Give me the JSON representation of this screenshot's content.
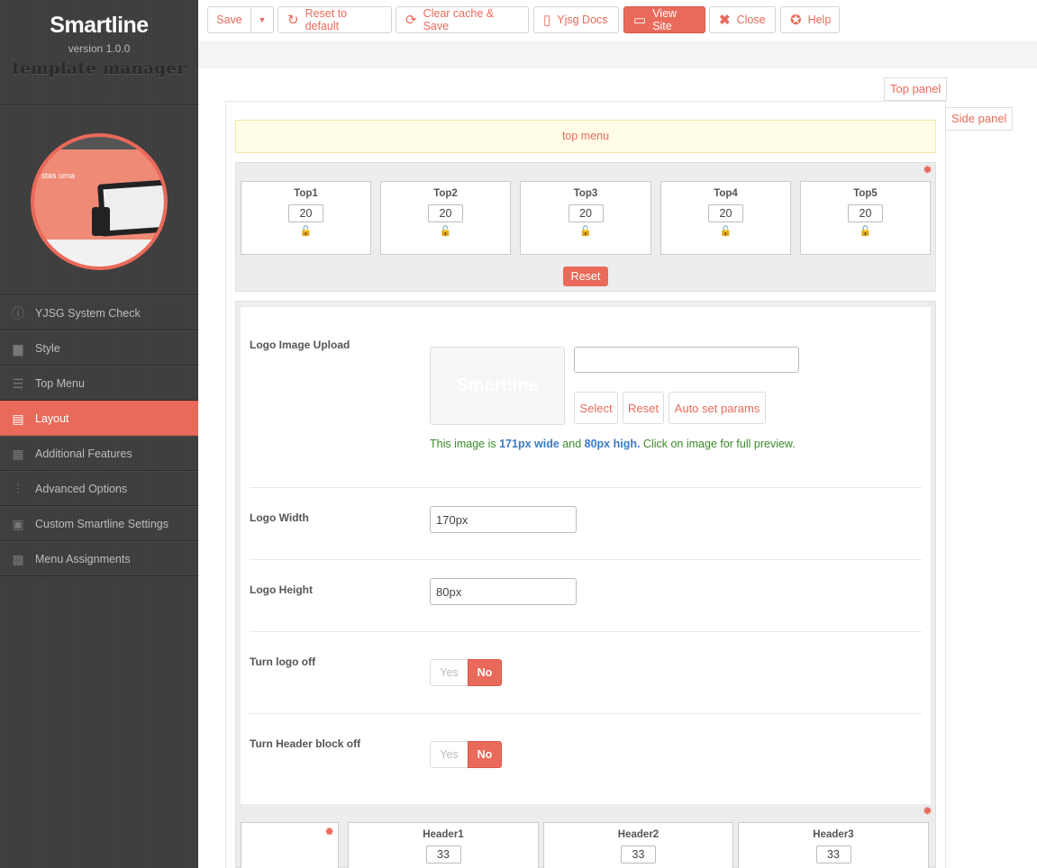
{
  "brand": {
    "title": "Smartline",
    "version": "version 1.0.0",
    "subtitle": "template manager",
    "preview_text": "stas urna"
  },
  "nav": [
    {
      "label": "YJSG System Check",
      "icon": "info-circle-icon"
    },
    {
      "label": "Style",
      "icon": "layers-icon"
    },
    {
      "label": "Top Menu",
      "icon": "menu-list-icon"
    },
    {
      "label": "Layout",
      "icon": "layout-icon",
      "active": true
    },
    {
      "label": "Additional Features",
      "icon": "features-icon"
    },
    {
      "label": "Advanced Options",
      "icon": "sliders-icon"
    },
    {
      "label": "Custom Smartline Settings",
      "icon": "custom-settings-icon"
    },
    {
      "label": "Menu Assignments",
      "icon": "sitemap-icon"
    }
  ],
  "toolbar": {
    "save": "Save",
    "reset_default": "Reset to default",
    "clear_cache": "Clear cache & Save",
    "docs": "Yjsg Docs",
    "view_site": "View Site",
    "close": "Close",
    "help": "Help"
  },
  "tabs": {
    "top_panel": "Top panel",
    "side_panel": "Side panel"
  },
  "top_menu_label": "top menu",
  "top_positions": [
    {
      "name": "Top1",
      "value": "20"
    },
    {
      "name": "Top2",
      "value": "20"
    },
    {
      "name": "Top3",
      "value": "20"
    },
    {
      "name": "Top4",
      "value": "20"
    },
    {
      "name": "Top5",
      "value": "20"
    }
  ],
  "reset_label": "Reset",
  "logo": {
    "upload_label": "Logo Image Upload",
    "thumb_text": "Smartline",
    "path_value": "",
    "select": "Select",
    "reset": "Reset",
    "auto": "Auto set params",
    "info_prefix": "This image is ",
    "info_width": "171px wide",
    "info_and": " and ",
    "info_height": "80px high.",
    "info_suffix": " Click on image for full preview."
  },
  "logo_width": {
    "label": "Logo Width",
    "value": "170px"
  },
  "logo_height": {
    "label": "Logo Height",
    "value": "80px"
  },
  "turn_logo_off": {
    "label": "Turn logo off",
    "yes": "Yes",
    "no": "No",
    "selected": "No"
  },
  "turn_header_off": {
    "label": "Turn Header block off",
    "yes": "Yes",
    "no": "No",
    "selected": "No"
  },
  "header_positions": [
    {
      "name": "Header1",
      "value": "33"
    },
    {
      "name": "Header2",
      "value": "33"
    },
    {
      "name": "Header3",
      "value": "33"
    }
  ],
  "colors": {
    "accent": "#e96a5a",
    "sidebar": "#3e3e3e"
  }
}
